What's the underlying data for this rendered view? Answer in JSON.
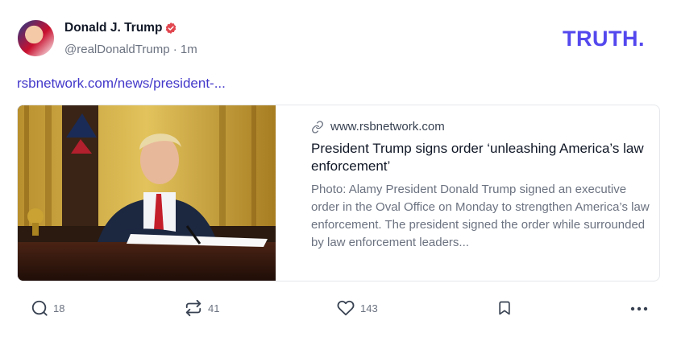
{
  "author": {
    "name": "Donald J. Trump",
    "handle": "@realDonaldTrump",
    "separator": "·",
    "time": "1m"
  },
  "brand": {
    "logo_text": "TRUTH.",
    "color": "#5448ee"
  },
  "post": {
    "link_text": "rsbnetwork.com/news/president-..."
  },
  "card": {
    "domain": "www.rsbnetwork.com",
    "title": "President Trump signs order ‘unleashing America’s law enforcement’",
    "description": "Photo: Alamy President Donald Trump signed an executive order in the Oval Office on Monday to strengthen America’s law enforcement. The president signed the order while surrounded by law enforcement leaders..."
  },
  "actions": {
    "replies": "18",
    "retruths": "41",
    "likes": "143"
  },
  "colors": {
    "accent": "#4338ca",
    "verified": "#e1464f",
    "muted": "#6b7280"
  }
}
